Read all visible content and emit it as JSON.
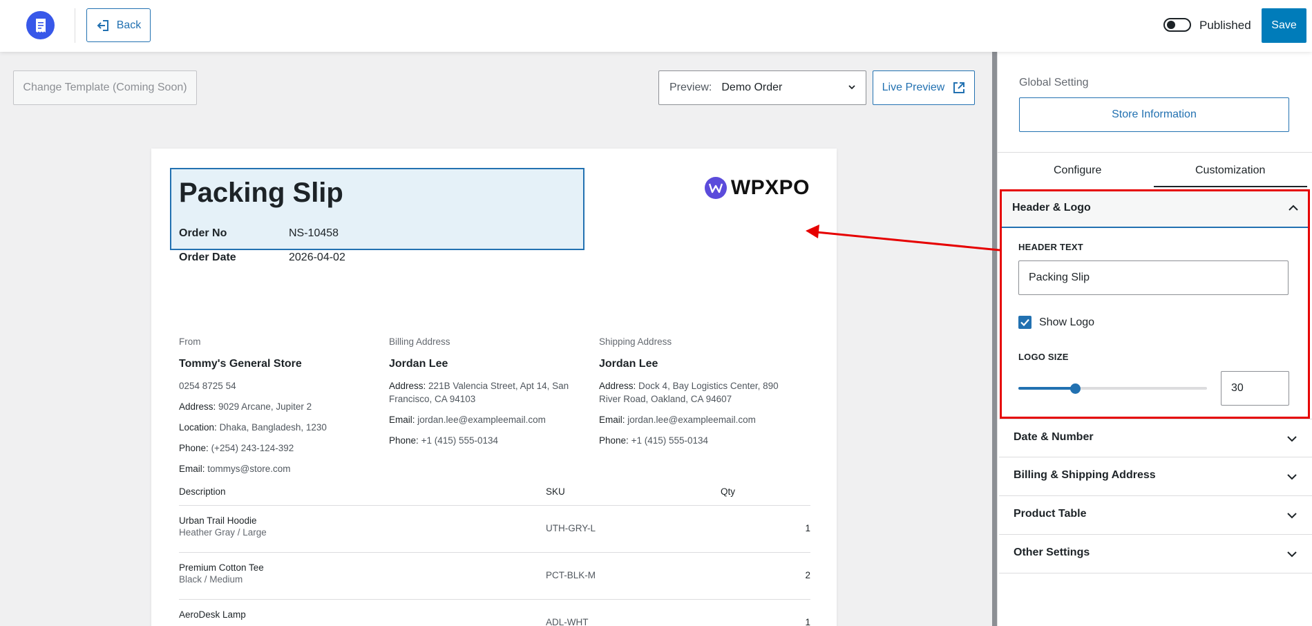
{
  "topbar": {
    "back_label": "Back",
    "published_label": "Published",
    "published_on": false,
    "save_label": "Save"
  },
  "toolbar": {
    "change_template_label": "Change Template (Coming Soon)",
    "preview_label": "Preview:",
    "preview_value": "Demo Order",
    "live_preview_label": "Live Preview"
  },
  "document": {
    "title": "Packing Slip",
    "brand": "WPXPO",
    "order_no_label": "Order No",
    "order_no": "NS-10458",
    "order_date_label": "Order Date",
    "order_date": "2026-04-02",
    "from": {
      "heading": "From",
      "name": "Tommy's General Store",
      "phone_plain": "0254 8725 54",
      "address_label": "Address:",
      "address": "9029 Arcane, Jupiter 2",
      "location_label": "Location:",
      "location": "Dhaka, Bangladesh, 1230",
      "phone_label": "Phone:",
      "phone": "(+254) 243-124-392",
      "email_label": "Email:",
      "email": "tommys@store.com"
    },
    "billing": {
      "heading": "Billing Address",
      "name": "Jordan Lee",
      "address_label": "Address:",
      "address": "221B Valencia Street, Apt 14, San Francisco, CA 94103",
      "email_label": "Email:",
      "email": "jordan.lee@exampleemail.com",
      "phone_label": "Phone:",
      "phone": "+1 (415) 555-0134"
    },
    "shipping": {
      "heading": "Shipping Address",
      "name": "Jordan Lee",
      "address_label": "Address:",
      "address": "Dock 4, Bay Logistics Center, 890 River Road, Oakland, CA 94607",
      "email_label": "Email:",
      "email": "jordan.lee@exampleemail.com",
      "phone_label": "Phone:",
      "phone": "+1 (415) 555-0134"
    },
    "table": {
      "headers": [
        "Description",
        "SKU",
        "Qty"
      ],
      "rows": [
        {
          "name": "Urban Trail Hoodie",
          "variant": "Heather Gray / Large",
          "sku": "UTH-GRY-L",
          "qty": "1"
        },
        {
          "name": "Premium Cotton Tee",
          "variant": "Black / Medium",
          "sku": "PCT-BLK-M",
          "qty": "2"
        },
        {
          "name": "AeroDesk Lamp",
          "variant": "",
          "sku": "ADL-WHT",
          "qty": "1"
        }
      ]
    }
  },
  "panel": {
    "global_setting_label": "Global Setting",
    "store_info_label": "Store Information",
    "tabs": [
      {
        "label": "Configure",
        "active": false
      },
      {
        "label": "Customization",
        "active": true
      }
    ],
    "header_logo": {
      "title": "Header & Logo",
      "header_text_label": "HEADER TEXT",
      "header_text_value": "Packing Slip",
      "show_logo_label": "Show Logo",
      "show_logo": true,
      "logo_size_label": "LOGO SIZE",
      "logo_size": "30",
      "logo_size_fraction": 0.3
    },
    "sections": [
      {
        "title": "Date & Number"
      },
      {
        "title": "Billing & Shipping Address"
      },
      {
        "title": "Product Table"
      },
      {
        "title": "Other Settings"
      }
    ]
  },
  "colors": {
    "accent": "#2271b1",
    "save": "#007cba",
    "highlight": "#e60000",
    "app_logo": "#3858e9"
  }
}
